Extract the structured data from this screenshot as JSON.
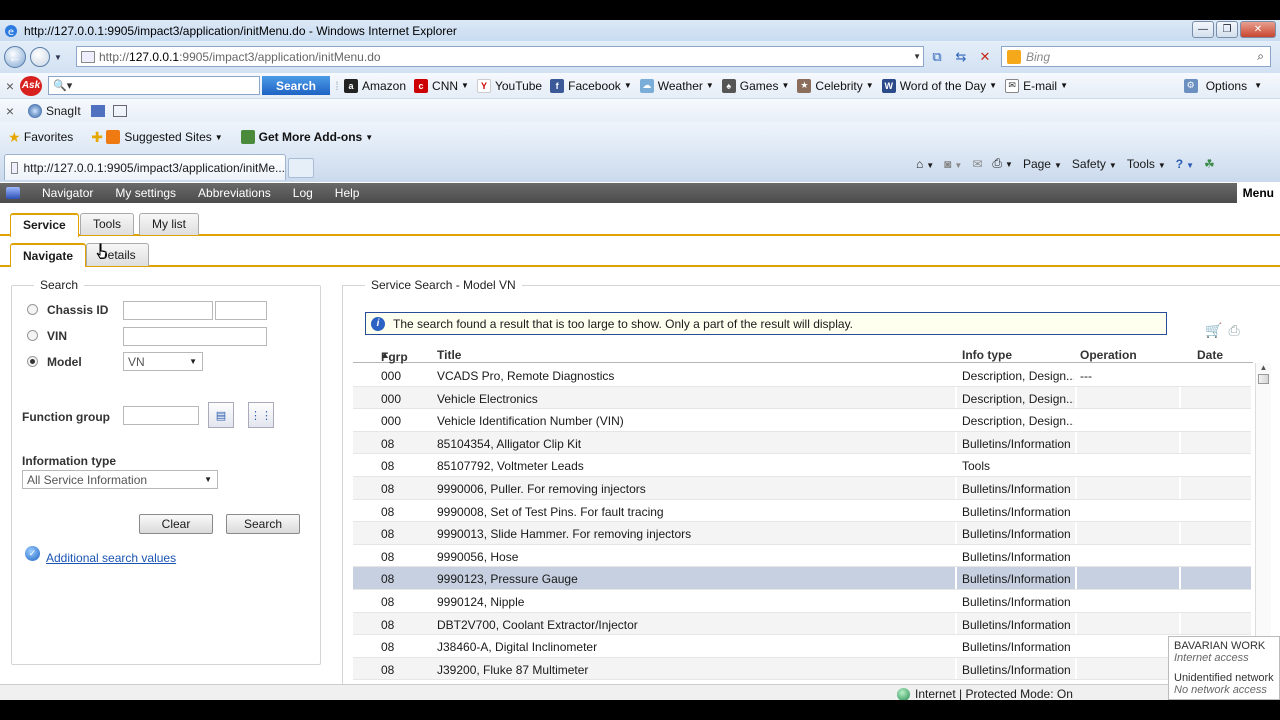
{
  "window": {
    "title": "http://127.0.0.1:9905/impact3/application/initMenu.do - Windows Internet Explorer"
  },
  "address": {
    "url_prefix": "http://",
    "url_host": "127.0.0.1",
    "url_rest": ":9905/impact3/application/initMenu.do",
    "bing_placeholder": "Bing"
  },
  "ask_toolbar": {
    "search_button": "Search",
    "links": [
      {
        "label": "Amazon",
        "icon": "amazon-icon"
      },
      {
        "label": "CNN",
        "icon": "cnn-icon"
      },
      {
        "label": "YouTube",
        "icon": "youtube-icon"
      },
      {
        "label": "Facebook",
        "icon": "facebook-icon"
      },
      {
        "label": "Weather",
        "icon": "weather-icon"
      },
      {
        "label": "Games",
        "icon": "games-icon"
      },
      {
        "label": "Celebrity",
        "icon": "celebrity-icon"
      },
      {
        "label": "Word of the Day",
        "icon": "dictionary-icon"
      },
      {
        "label": "E-mail",
        "icon": "email-icon"
      }
    ],
    "options": "Options"
  },
  "snagit": {
    "label": "SnagIt"
  },
  "favorites": {
    "favorites": "Favorites",
    "suggested": "Suggested Sites",
    "addons": "Get More Add-ons"
  },
  "page_tab": {
    "title": "http://127.0.0.1:9905/impact3/application/initMe..."
  },
  "command_bar": {
    "page": "Page",
    "safety": "Safety",
    "tools": "Tools"
  },
  "app_menu": {
    "items": [
      "Navigator",
      "My settings",
      "Abbreviations",
      "Log",
      "Help"
    ],
    "menu": "Menu"
  },
  "main_tabs": [
    "Service",
    "Tools",
    "My list"
  ],
  "sub_tabs": [
    "Navigate",
    "Details"
  ],
  "search_panel": {
    "legend": "Search",
    "chassis_label": "Chassis ID",
    "vin_label": "VIN",
    "model_label": "Model",
    "model_value": "VN",
    "function_group_label": "Function group",
    "info_type_label": "Information type",
    "info_type_value": "All Service Information",
    "clear_button": "Clear",
    "search_button": "Search",
    "additional_link": "Additional search values"
  },
  "results": {
    "legend": "Service Search - Model VN",
    "message": "The search found a result that is too large to show. Only a part of the result will display.",
    "columns": {
      "fgrp": "Fgrp",
      "title": "Title",
      "info": "Info type",
      "operation": "Operation",
      "date": "Date"
    },
    "sort_indicator": "▲",
    "rows": [
      {
        "fgrp": "000",
        "title": "VCADS Pro, Remote Diagnostics",
        "info": "Description, Design...",
        "op": "---"
      },
      {
        "fgrp": "000",
        "title": "Vehicle Electronics",
        "info": "Description, Design...",
        "op": ""
      },
      {
        "fgrp": "000",
        "title": "Vehicle Identification Number (VIN)",
        "info": "Description, Design...",
        "op": ""
      },
      {
        "fgrp": "08",
        "title": "85104354, Alligator Clip Kit",
        "info": "Bulletins/Information",
        "op": ""
      },
      {
        "fgrp": "08",
        "title": "85107792, Voltmeter Leads",
        "info": "Tools",
        "op": ""
      },
      {
        "fgrp": "08",
        "title": "9990006, Puller. For removing injectors",
        "info": "Bulletins/Information",
        "op": ""
      },
      {
        "fgrp": "08",
        "title": "9990008, Set of Test Pins. For fault tracing",
        "info": "Bulletins/Information",
        "op": ""
      },
      {
        "fgrp": "08",
        "title": "9990013, Slide Hammer. For removing injectors",
        "info": "Bulletins/Information",
        "op": ""
      },
      {
        "fgrp": "08",
        "title": "9990056, Hose",
        "info": "Bulletins/Information",
        "op": ""
      },
      {
        "fgrp": "08",
        "title": "9990123, Pressure Gauge",
        "info": "Bulletins/Information",
        "op": ""
      },
      {
        "fgrp": "08",
        "title": "9990124, Nipple",
        "info": "Bulletins/Information",
        "op": ""
      },
      {
        "fgrp": "08",
        "title": "DBT2V700, Coolant Extractor/Injector",
        "info": "Bulletins/Information",
        "op": ""
      },
      {
        "fgrp": "08",
        "title": "J38460-A, Digital Inclinometer",
        "info": "Bulletins/Information",
        "op": ""
      },
      {
        "fgrp": "08",
        "title": "J39200, Fluke 87 Multimeter",
        "info": "Bulletins/Information",
        "op": ""
      }
    ],
    "selected_row": 9
  },
  "status": {
    "zone": "Internet | Protected Mode: On"
  },
  "network_popup": {
    "name": "BAVARIAN WORK",
    "access": "Internet access",
    "name2": "Unidentified network",
    "access2": "No network access"
  }
}
